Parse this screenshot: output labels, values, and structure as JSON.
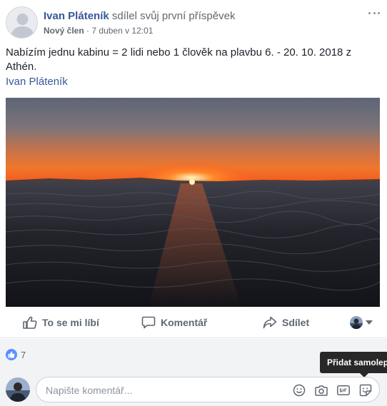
{
  "post": {
    "author_name": "Ivan Pláteník",
    "author_action": "sdílel svůj první příspěvek",
    "badge": "Nový člen",
    "timestamp": "7 duben v 12:01",
    "meta_separator": "·",
    "text": "Nabízím jednu kabinu = 2 lidi nebo 1 člověk na plavbu 6. - 20. 10. 2018 z Athén.",
    "link_text": "Ivan Pláteník"
  },
  "actions": {
    "like_label": "To se mi líbí",
    "comment_label": "Komentář",
    "share_label": "Sdílet"
  },
  "reactions": {
    "like_count": "7"
  },
  "tooltip": {
    "text": "Přidat samolepku"
  },
  "comment": {
    "placeholder": "Napište komentář..."
  },
  "colors": {
    "link_blue": "#365899",
    "like_blue": "#5890ff",
    "muted_gray": "#616770"
  }
}
